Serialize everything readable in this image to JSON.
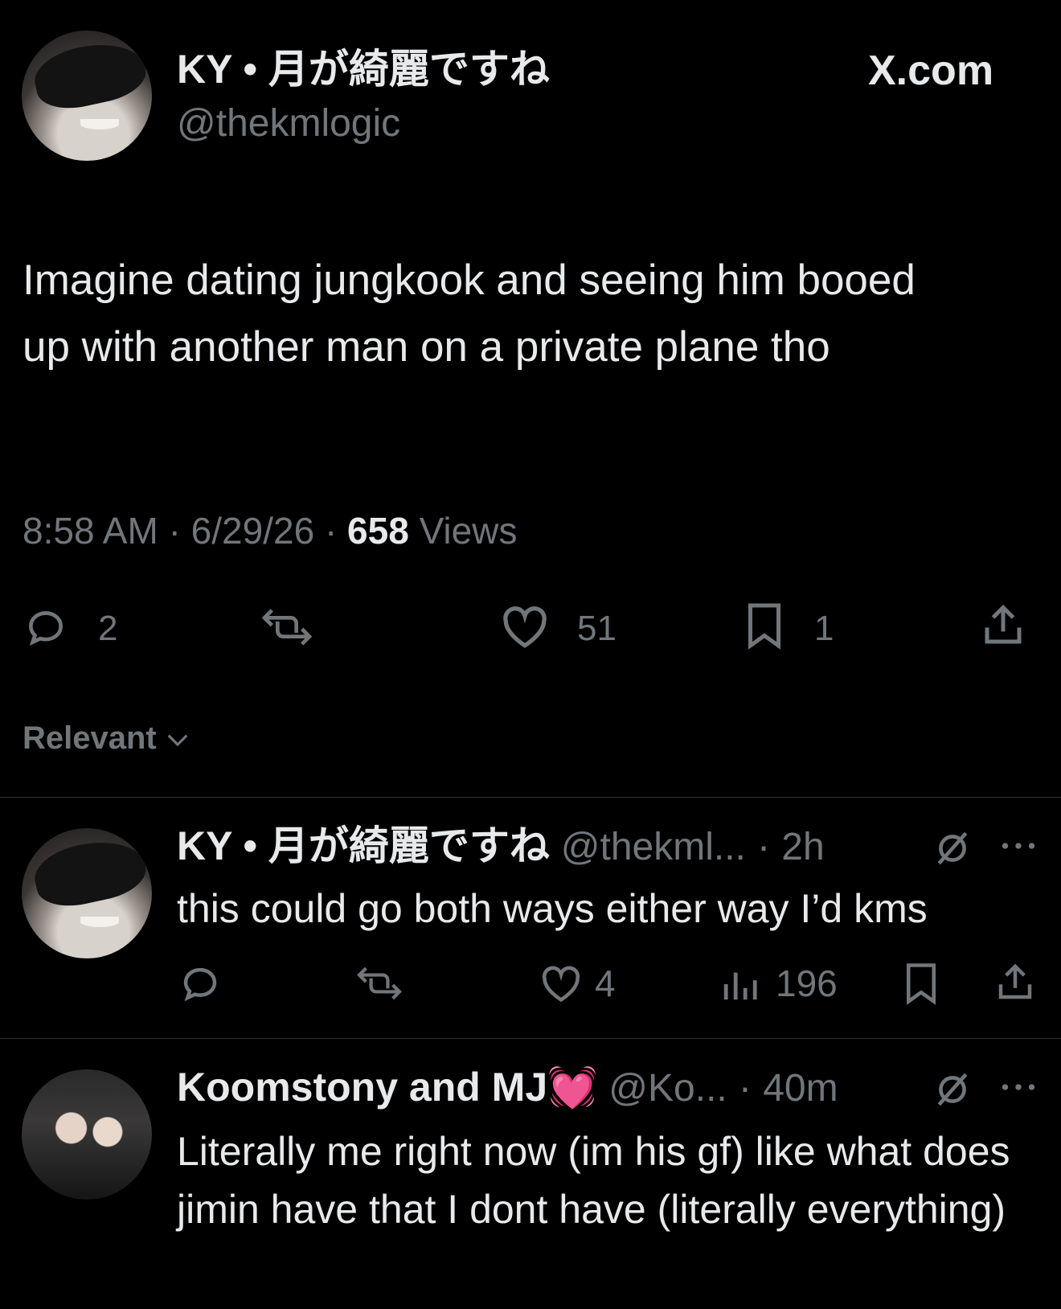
{
  "header": {
    "display_name": "KY • 月が綺麗ですね",
    "handle": "@thekmlogic",
    "site_label": "X.com"
  },
  "tweet": {
    "text": "Imagine dating jungkook and seeing him booed up with another man on a private plane tho",
    "time": "8:58 AM",
    "date": "6/29/26",
    "views_count": "658",
    "views_label": "Views",
    "actions": {
      "replies": "2",
      "likes": "51",
      "bookmarks": "1"
    }
  },
  "sort": {
    "label": "Relevant"
  },
  "replies": [
    {
      "display_name": "KY • 月が綺麗ですね",
      "handle": "@thekml...",
      "time": "2h",
      "text": "this could go both ways either way I’d kms",
      "likes": "4",
      "views": "196"
    },
    {
      "display_name": "Koomstony and MJ💓",
      "handle": "@Ko...",
      "time": "40m",
      "text": "Literally me right now (im his gf) like what does jimin have that I dont have (literally everything)"
    }
  ],
  "colors": {
    "background": "#000000",
    "text": "#e7e9ea",
    "muted": "#71767b",
    "divider": "#2f3336"
  }
}
